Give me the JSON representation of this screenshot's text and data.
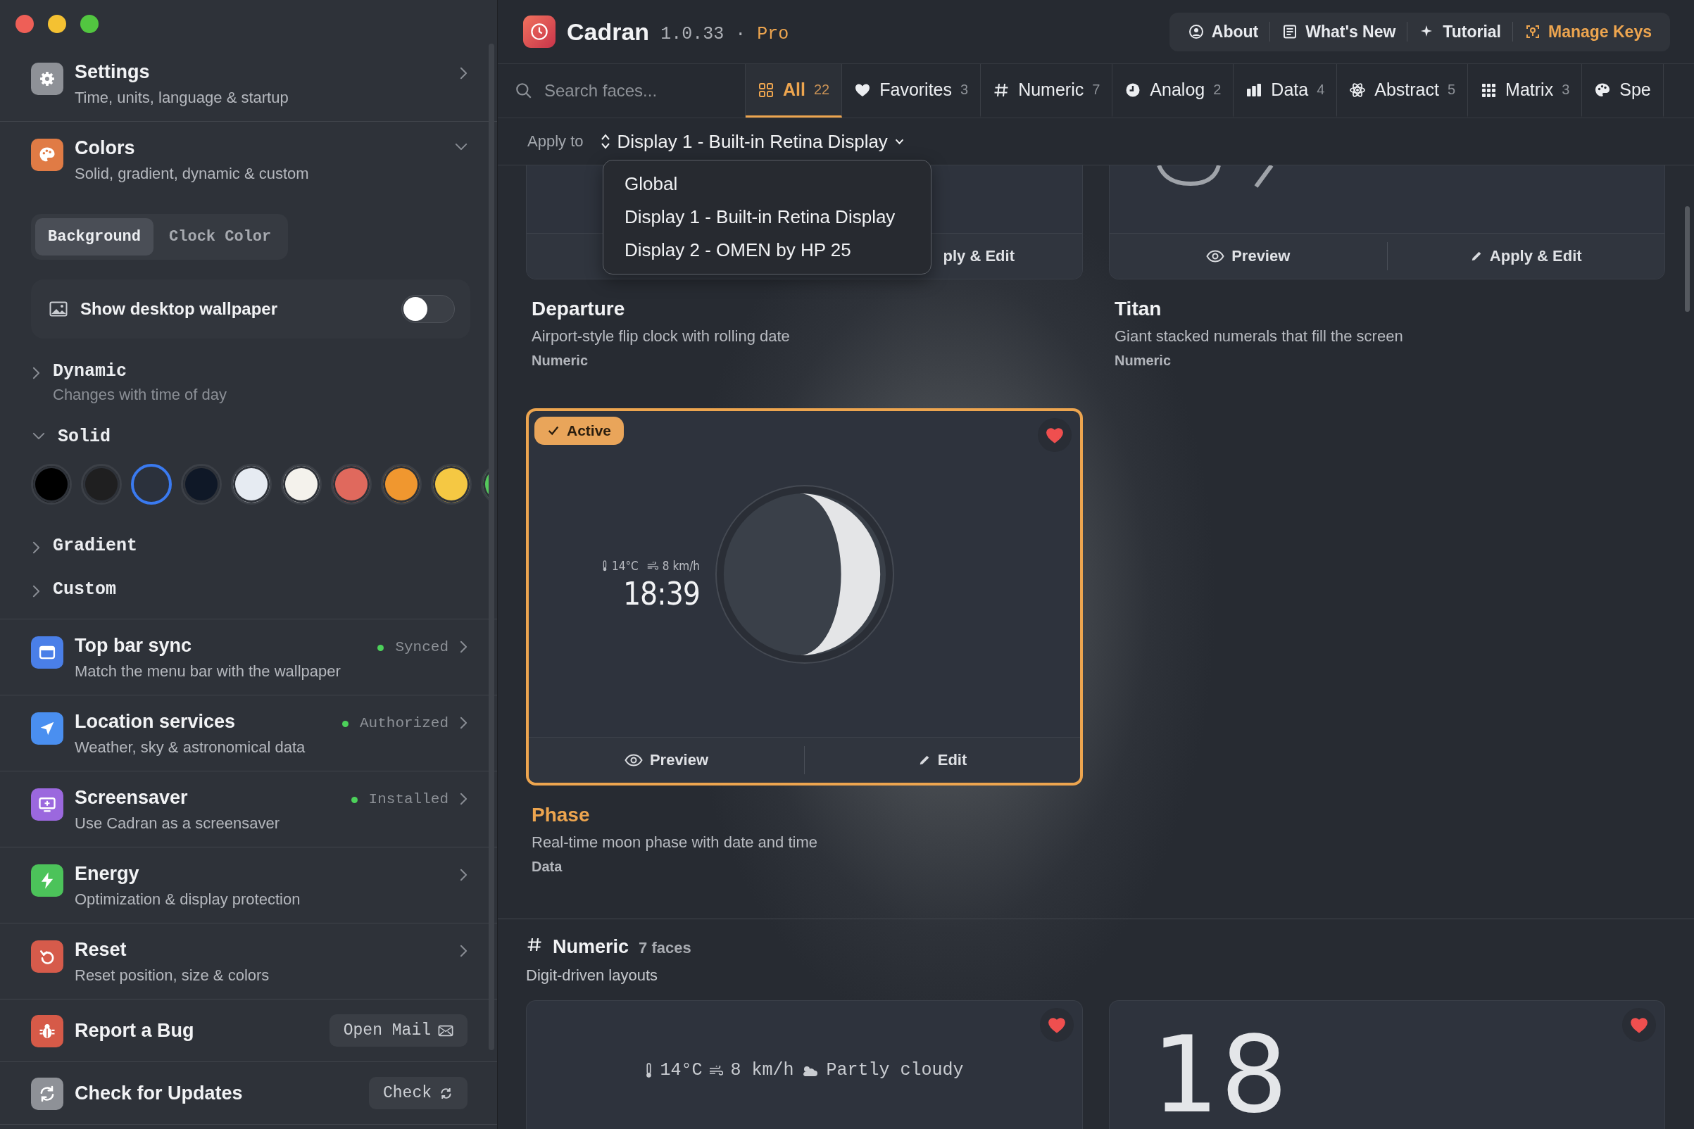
{
  "sidebar": {
    "items": [
      {
        "kind": "nav",
        "title": "Settings",
        "subtitle": "Time, units, language & startup",
        "color": "#8e9197"
      },
      {
        "kind": "section",
        "title": "Colors",
        "subtitle": "Solid, gradient, dynamic & custom",
        "color": "#e07b45",
        "expanded": true,
        "segments": [
          {
            "label": "Background",
            "selected": true
          },
          {
            "label": "Clock Color",
            "selected": false
          }
        ],
        "wallpaper_toggle": {
          "label": "Show desktop wallpaper",
          "on": false
        },
        "groups": [
          {
            "label": "Dynamic",
            "subtitle": "Changes with time of day",
            "expanded": false
          },
          {
            "label": "Solid",
            "expanded": true,
            "swatches": [
              {
                "color": "#000000",
                "selected": false
              },
              {
                "color": "#1f1f20",
                "selected": false
              },
              {
                "color": "#2b313c",
                "selected": true
              },
              {
                "color": "#0f1827",
                "selected": false
              },
              {
                "color": "#e6ebf2",
                "selected": false
              },
              {
                "color": "#f4f2ec",
                "selected": false
              },
              {
                "color": "#e0695d",
                "selected": false
              },
              {
                "color": "#f0972f",
                "selected": false
              },
              {
                "color": "#f5c843",
                "selected": false
              },
              {
                "color": "#55c85c",
                "selected": false
              }
            ]
          },
          {
            "label": "Gradient",
            "expanded": false
          },
          {
            "label": "Custom",
            "expanded": false
          }
        ]
      },
      {
        "kind": "nav",
        "title": "Top bar sync",
        "subtitle": "Match the menu bar with the wallpaper",
        "color": "#4a7fe8",
        "status": "Synced"
      },
      {
        "kind": "nav",
        "title": "Location services",
        "subtitle": "Weather, sky & astronomical data",
        "color": "#4a8ff0",
        "status": "Authorized"
      },
      {
        "kind": "nav",
        "title": "Screensaver",
        "subtitle": "Use Cadran as a screensaver",
        "color": "#9b68de",
        "status": "Installed"
      },
      {
        "kind": "nav",
        "title": "Energy",
        "subtitle": "Optimization & display protection",
        "color": "#4cc35a"
      },
      {
        "kind": "nav",
        "title": "Reset",
        "subtitle": "Reset position, size & colors",
        "color": "#d65b4b"
      },
      {
        "kind": "button",
        "title": "Report a Bug",
        "color": "#d65a48",
        "button": "Open Mail"
      },
      {
        "kind": "button",
        "title": "Check for Updates",
        "color": "#8e9197",
        "button": "Check"
      }
    ]
  },
  "app": {
    "name": "Cadran",
    "version": "1.0.33",
    "separator": "·",
    "edition": "Pro"
  },
  "header_buttons": [
    {
      "label": "About",
      "kind": "plain"
    },
    {
      "label": "What's New",
      "kind": "plain"
    },
    {
      "label": "Tutorial",
      "kind": "plain"
    },
    {
      "label": "Manage Keys",
      "kind": "accent"
    }
  ],
  "search": {
    "placeholder": "Search faces..."
  },
  "filter_tabs": [
    {
      "label": "All",
      "count": "22",
      "selected": true
    },
    {
      "label": "Favorites",
      "count": "3",
      "selected": false
    },
    {
      "label": "Numeric",
      "count": "7",
      "selected": false
    },
    {
      "label": "Analog",
      "count": "2",
      "selected": false
    },
    {
      "label": "Data",
      "count": "4",
      "selected": false
    },
    {
      "label": "Abstract",
      "count": "5",
      "selected": false
    },
    {
      "label": "Matrix",
      "count": "3",
      "selected": false
    },
    {
      "label": "Spe",
      "selected": false
    }
  ],
  "apply_to": {
    "label": "Apply to",
    "value": "Display 1 - Built-in Retina Display"
  },
  "display_menu": {
    "items": [
      {
        "label": "Global"
      },
      {
        "label": "Display 1 - Built-in Retina Display"
      },
      {
        "label": "Display 2 - OMEN by HP 25"
      }
    ]
  },
  "faces": [
    {
      "title": "Departure",
      "description": "Airport-style flip clock with rolling date",
      "category": "Numeric",
      "active": false,
      "actions": [
        {
          "label": "ply & Edit",
          "kind": "text"
        }
      ]
    },
    {
      "title": "Titan",
      "description": "Giant stacked numerals that fill the screen",
      "category": "Numeric",
      "active": false,
      "actions": [
        {
          "label": "Preview",
          "kind": "preview"
        },
        {
          "label": "Apply & Edit",
          "kind": "edit"
        }
      ]
    },
    {
      "title": "Phase",
      "description": "Real-time moon phase with date and time",
      "category": "Data",
      "active": true,
      "badge": "Active",
      "favorite": true,
      "temperature": "14°C",
      "wind": "8 km/h",
      "time": "18:39",
      "actions": [
        {
          "label": "Preview",
          "kind": "preview"
        },
        {
          "label": "Edit",
          "kind": "edit"
        }
      ]
    }
  ],
  "sections": [
    {
      "title": "Numeric",
      "count": "7 faces",
      "subtitle": "Digit-driven layouts",
      "cards": [
        {
          "kind": "weather",
          "favorite": true,
          "temperature": "14°C",
          "wind": "8 km/h",
          "condition": "Partly cloudy"
        },
        {
          "kind": "bignum",
          "favorite": true,
          "text": "18"
        }
      ]
    }
  ]
}
